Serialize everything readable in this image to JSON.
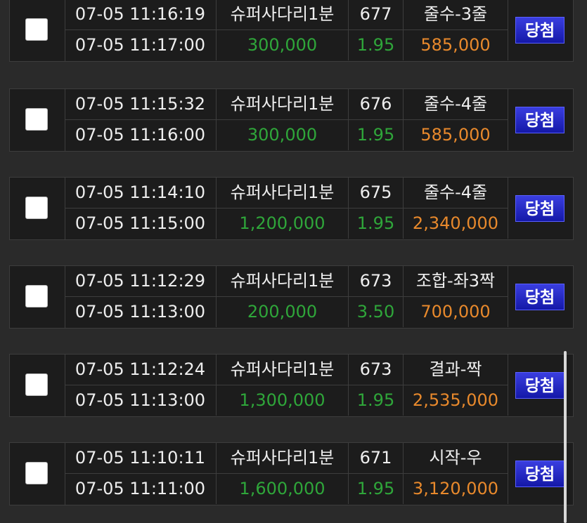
{
  "bets": [
    {
      "bet_time": "07-05 11:16:19",
      "game": "슈퍼사다리1분",
      "round": "677",
      "pick": "줄수-3줄",
      "draw_time": "07-05 11:17:00",
      "amount": "300,000",
      "odds": "1.95",
      "payout": "585,000",
      "result": "당첨"
    },
    {
      "bet_time": "07-05 11:15:32",
      "game": "슈퍼사다리1분",
      "round": "676",
      "pick": "줄수-4줄",
      "draw_time": "07-05 11:16:00",
      "amount": "300,000",
      "odds": "1.95",
      "payout": "585,000",
      "result": "당첨"
    },
    {
      "bet_time": "07-05 11:14:10",
      "game": "슈퍼사다리1분",
      "round": "675",
      "pick": "줄수-4줄",
      "draw_time": "07-05 11:15:00",
      "amount": "1,200,000",
      "odds": "1.95",
      "payout": "2,340,000",
      "result": "당첨"
    },
    {
      "bet_time": "07-05 11:12:29",
      "game": "슈퍼사다리1분",
      "round": "673",
      "pick": "조합-좌3짝",
      "draw_time": "07-05 11:13:00",
      "amount": "200,000",
      "odds": "3.50",
      "payout": "700,000",
      "result": "당첨"
    },
    {
      "bet_time": "07-05 11:12:24",
      "game": "슈퍼사다리1분",
      "round": "673",
      "pick": "결과-짝",
      "draw_time": "07-05 11:13:00",
      "amount": "1,300,000",
      "odds": "1.95",
      "payout": "2,535,000",
      "result": "당첨"
    },
    {
      "bet_time": "07-05 11:10:11",
      "game": "슈퍼사다리1분",
      "round": "671",
      "pick": "시작-우",
      "draw_time": "07-05 11:11:00",
      "amount": "1,600,000",
      "odds": "1.95",
      "payout": "3,120,000",
      "result": "당첨"
    }
  ],
  "colors": {
    "amount_green": "#2fa63a",
    "payout_orange": "#e8892c",
    "win_badge_blue": "#1e22c8"
  }
}
